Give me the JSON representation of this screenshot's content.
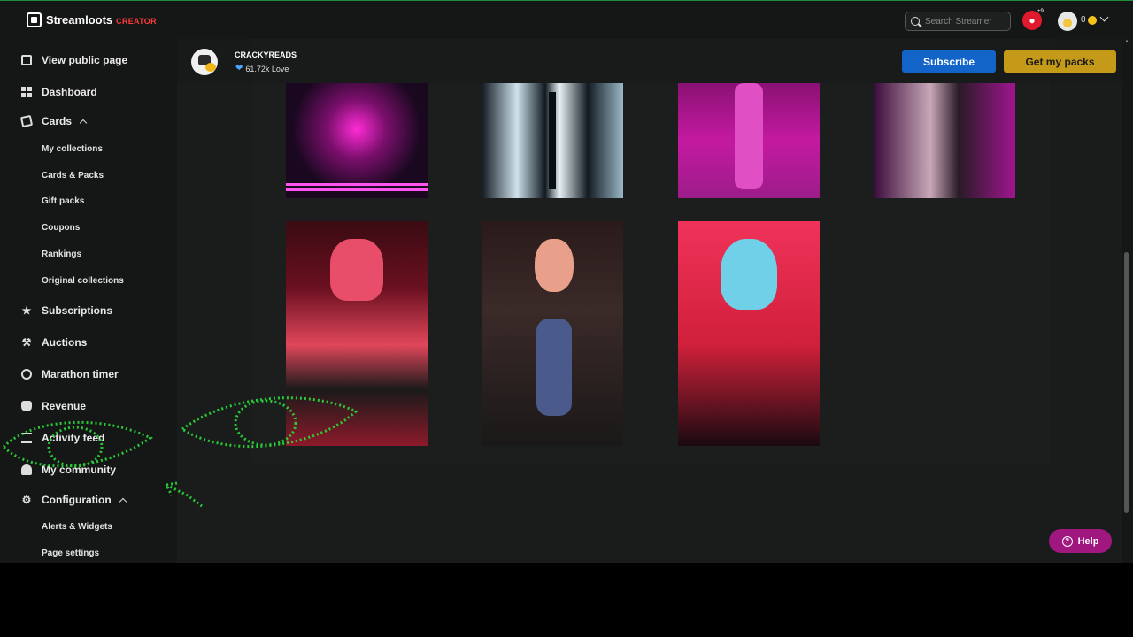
{
  "brand": {
    "name": "Streamloots",
    "tag": "CREATOR"
  },
  "header": {
    "search_placeholder": "Search Streamer",
    "notification_badge": "+9",
    "coins": "0"
  },
  "sidebar": {
    "items": [
      {
        "label": "View public page"
      },
      {
        "label": "Dashboard"
      },
      {
        "label": "Cards"
      },
      {
        "label": "Subscriptions"
      },
      {
        "label": "Auctions"
      },
      {
        "label": "Marathon timer"
      },
      {
        "label": "Revenue"
      },
      {
        "label": "Activity feed"
      },
      {
        "label": "My community"
      },
      {
        "label": "Configuration"
      }
    ],
    "cards_sub": [
      "My collections",
      "Cards & Packs",
      "Gift packs",
      "Coupons",
      "Rankings",
      "Original collections"
    ],
    "config_sub": [
      "Alerts & Widgets",
      "Page settings"
    ]
  },
  "creator": {
    "name": "CRACKYREADS",
    "love": "61.72k Love",
    "subscribe_label": "Subscribe",
    "get_packs_label": "Get my packs"
  },
  "help": {
    "label": "Help"
  },
  "colors": {
    "subscribe": "#1264c9",
    "get_packs": "#c49a18",
    "help": "#a0177f",
    "annotation": "#2bdc3a"
  }
}
